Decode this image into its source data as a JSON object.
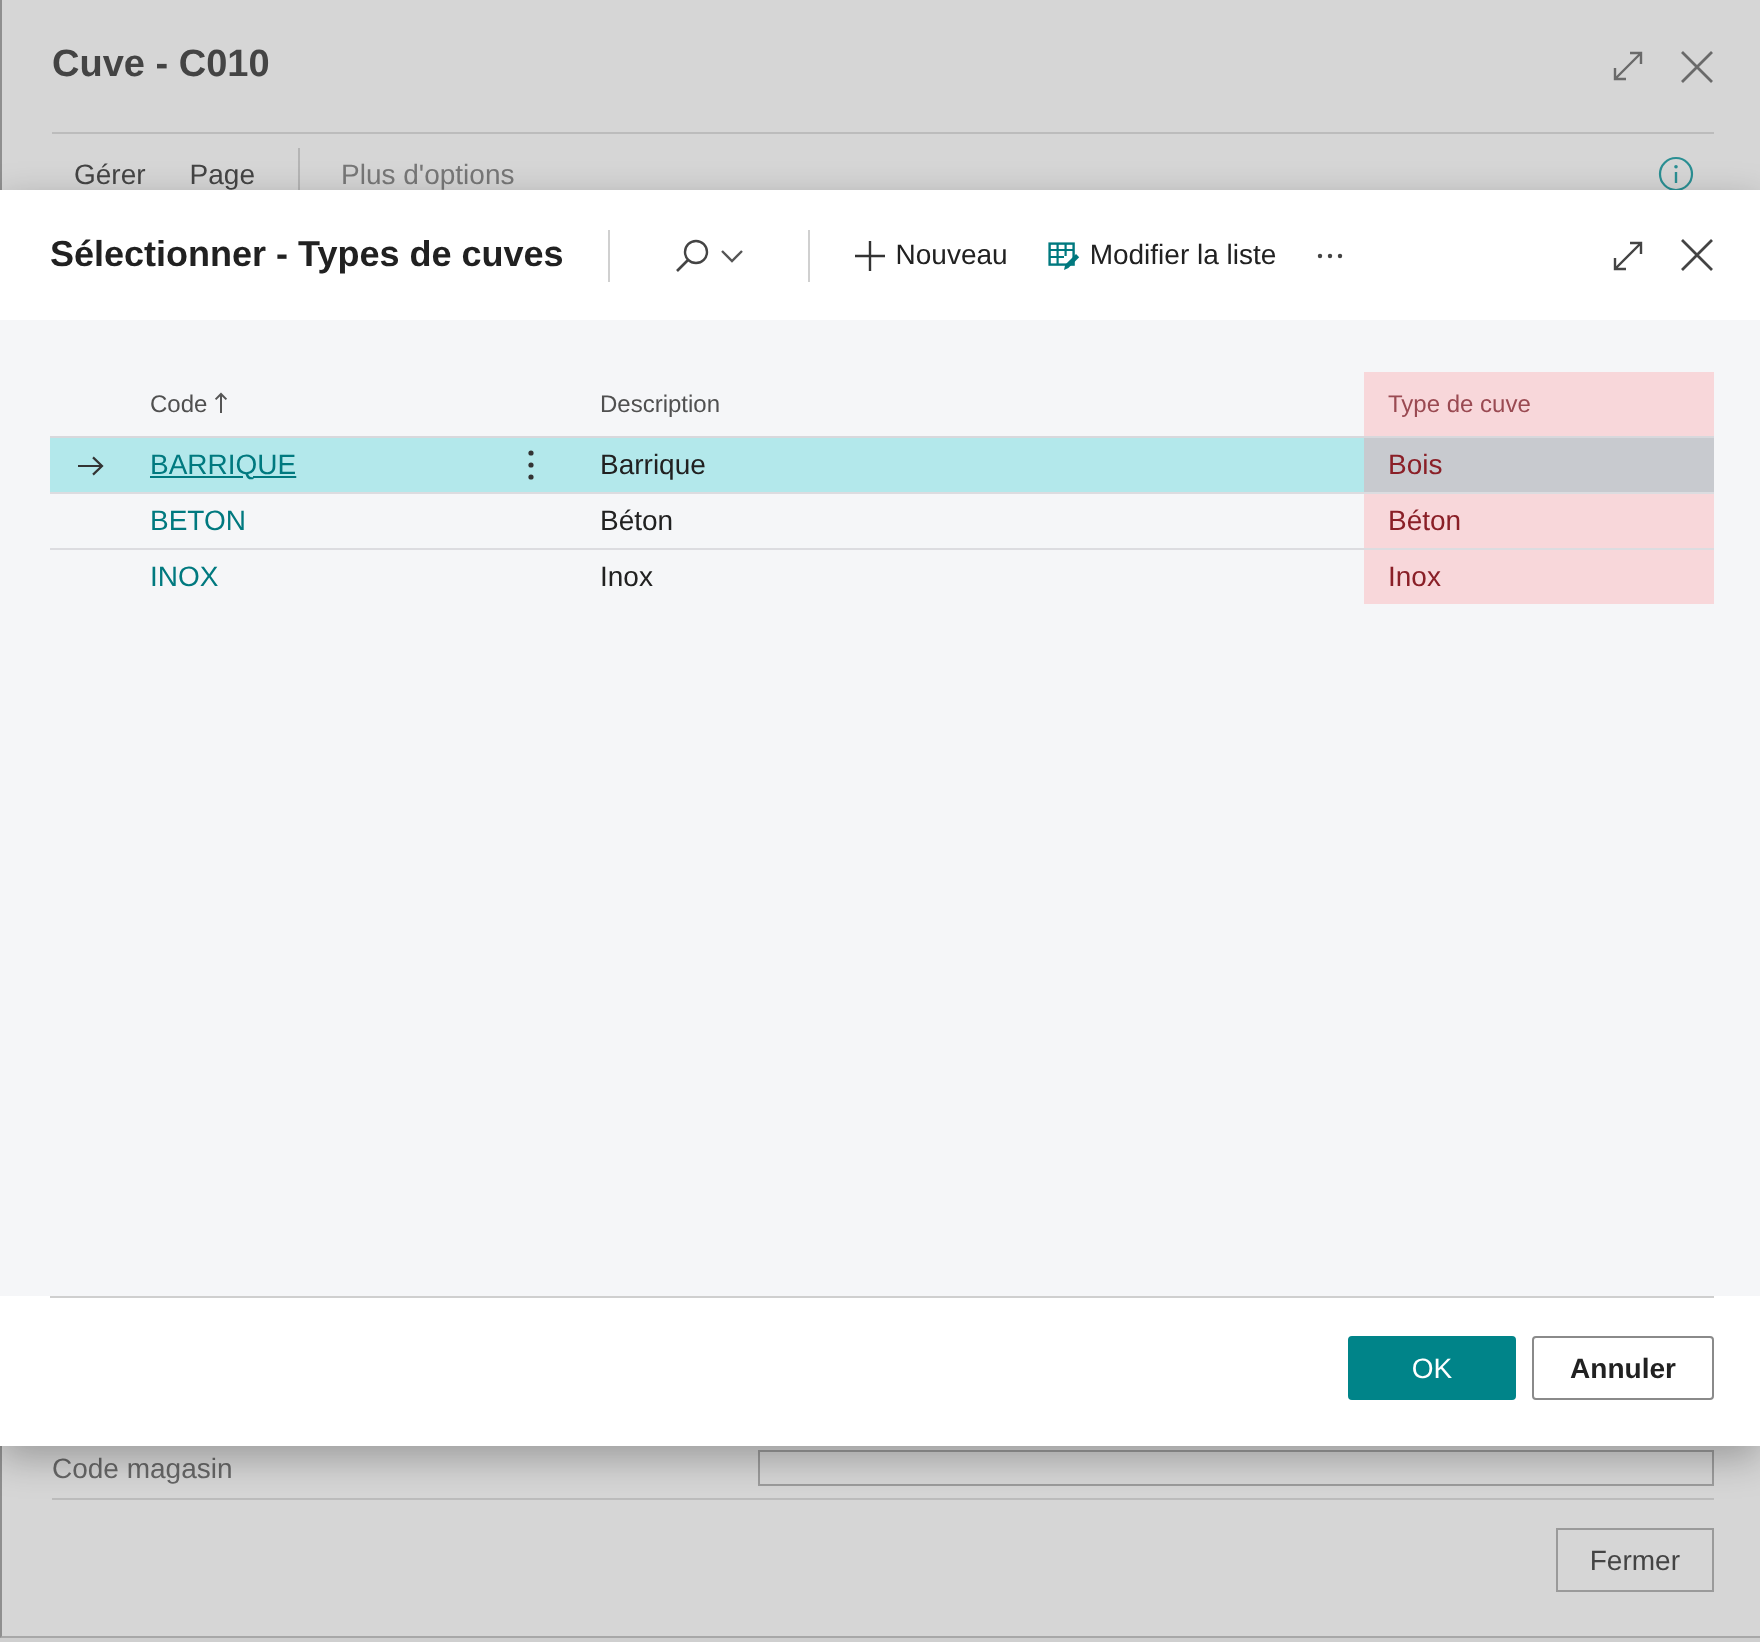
{
  "background_window": {
    "title": "Cuve - C010",
    "actions": [
      {
        "kind": "menu",
        "label": "Gérer"
      },
      {
        "kind": "menu",
        "label": "Page"
      },
      {
        "kind": "more",
        "label": "Plus d'options"
      }
    ],
    "fields": [
      {
        "label": "Code magasin"
      }
    ],
    "buttons": [
      "Fermer"
    ]
  },
  "dialog": {
    "title": "Sélectionner - Types de cuves",
    "toolbar": [
      {
        "kind": "search"
      },
      {
        "kind": "new",
        "label": "Nouveau"
      },
      {
        "kind": "edit_list",
        "label": "Modifier la liste"
      },
      {
        "kind": "more"
      }
    ],
    "table": {
      "columns": [
        {
          "label": "Code",
          "sorted": true,
          "highlighted": false
        },
        {
          "label": "Description",
          "sorted": false,
          "highlighted": false
        },
        {
          "label": "Type de cuve",
          "sorted": false,
          "highlighted": true
        }
      ],
      "rows": [
        {
          "cells": [
            "BARRIQUE",
            "Barrique",
            "Bois"
          ],
          "selected": true
        },
        {
          "cells": [
            "BETON",
            "Béton",
            "Béton"
          ],
          "selected": false
        },
        {
          "cells": [
            "INOX",
            "Inox",
            "Inox"
          ],
          "selected": false
        }
      ]
    },
    "buttons": [
      {
        "label": "OK",
        "primary": true
      },
      {
        "label": "Annuler",
        "primary": false
      }
    ]
  }
}
